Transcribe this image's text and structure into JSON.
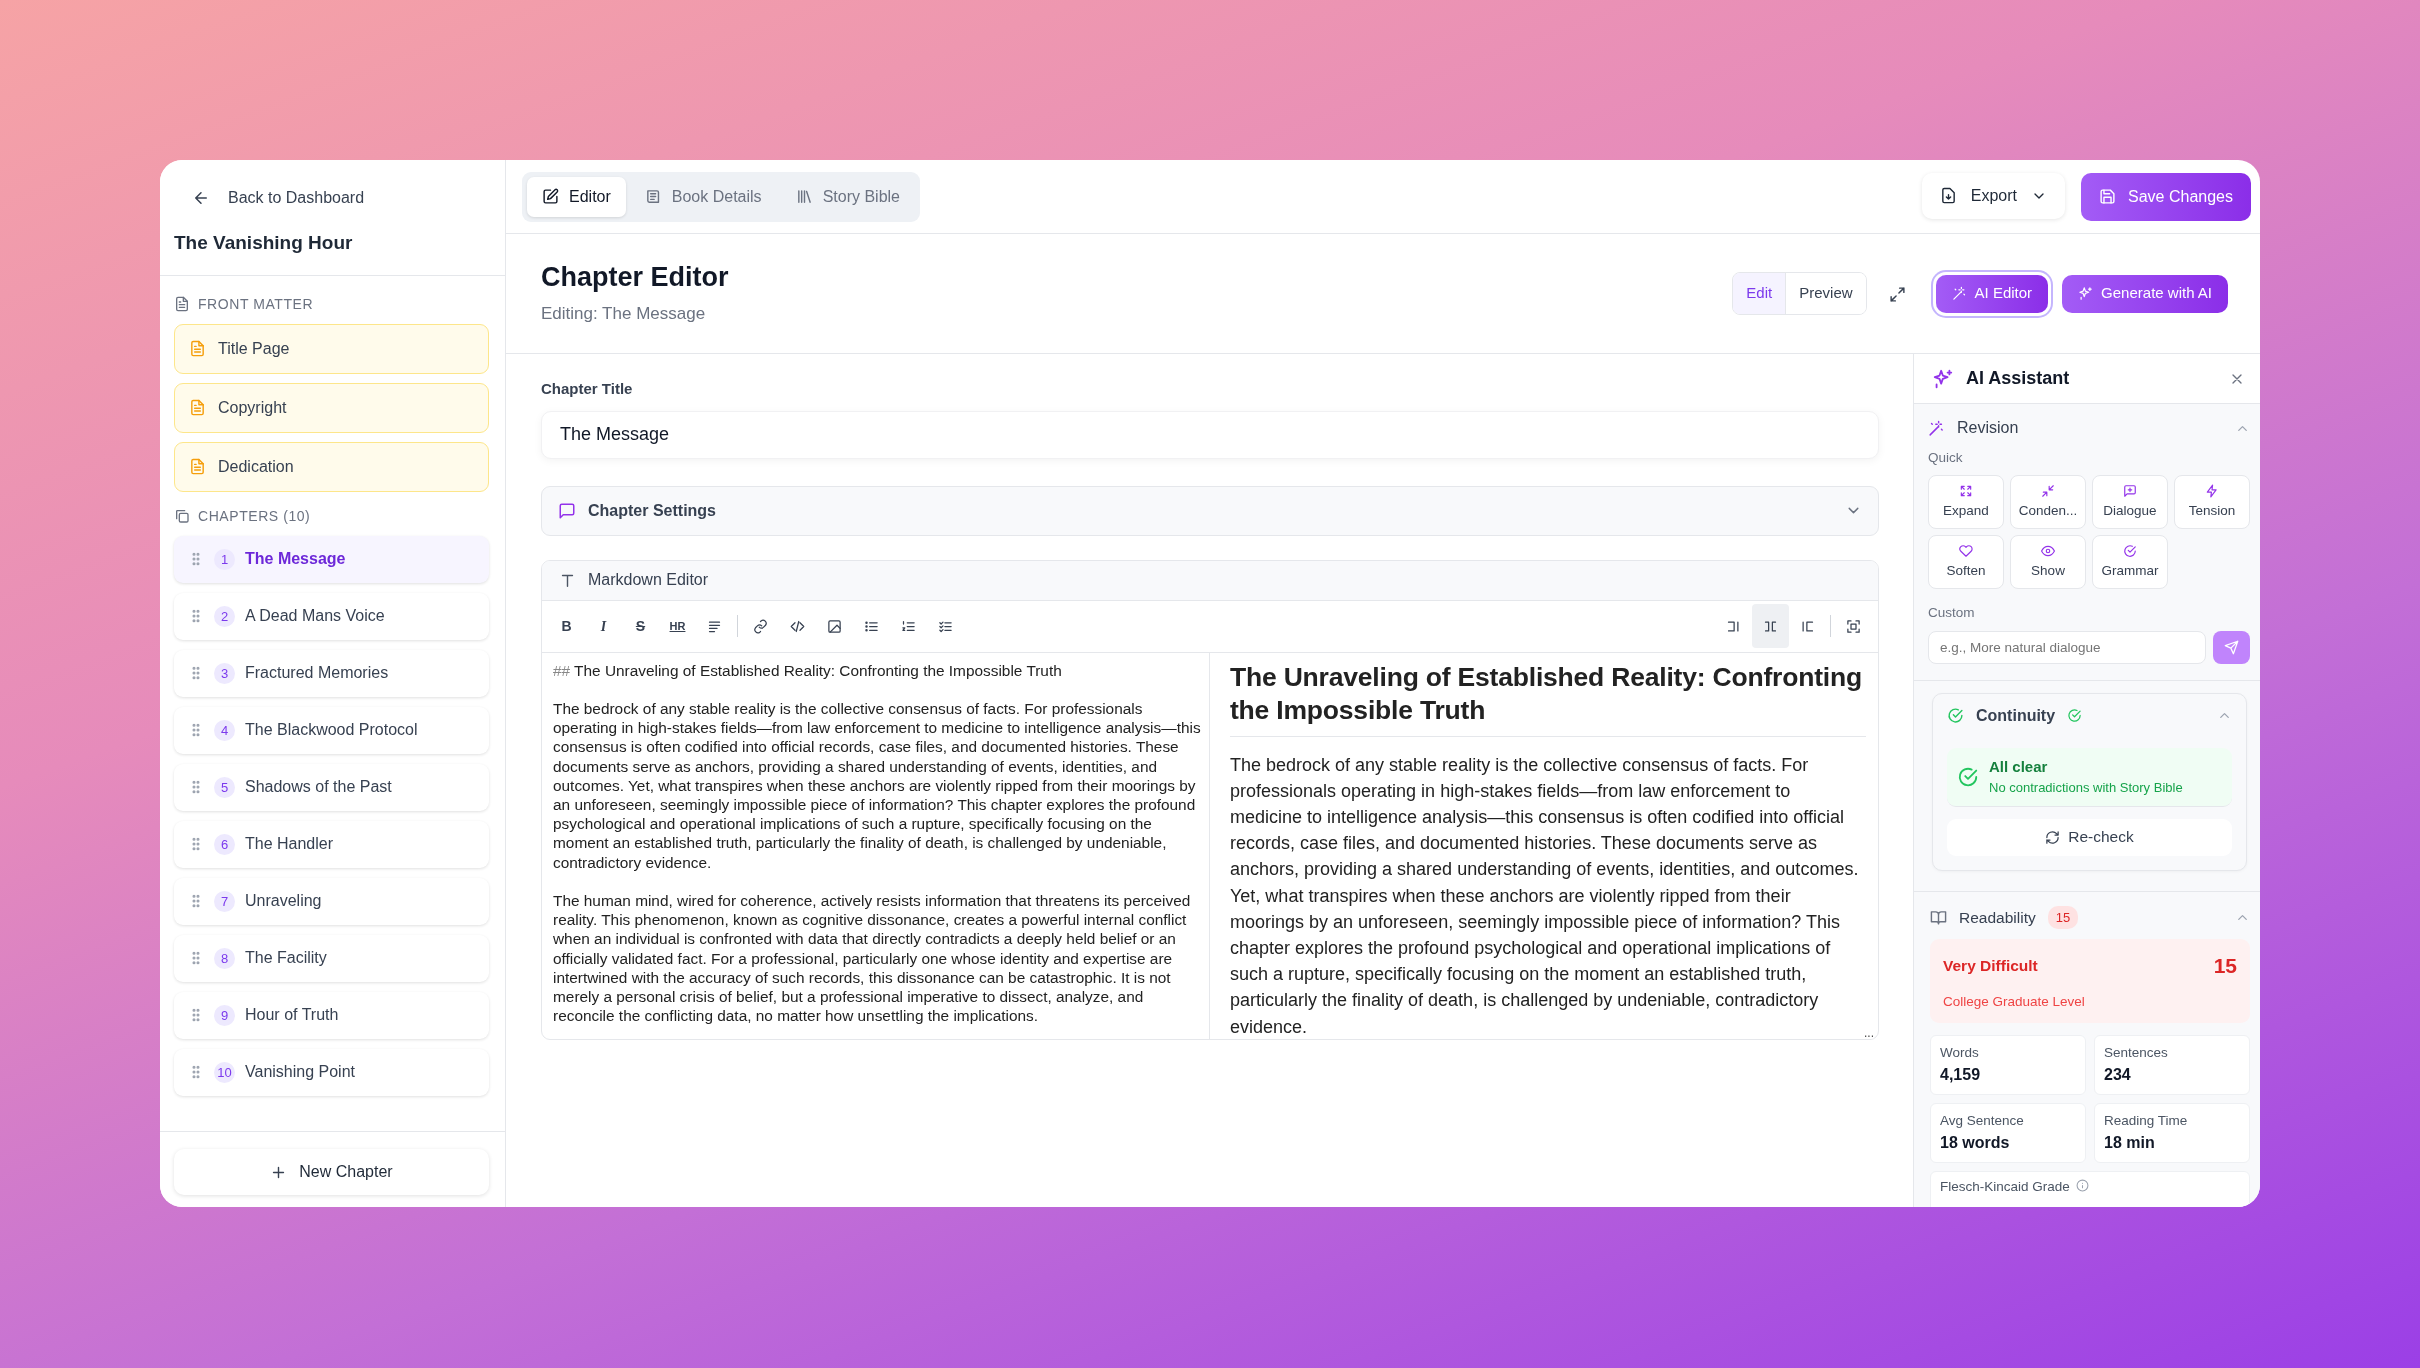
{
  "sidebar": {
    "back_link": "Back to Dashboard",
    "book_title": "The Vanishing Hour",
    "front_matter": {
      "heading": "FRONT MATTER",
      "items": [
        {
          "label": "Title Page"
        },
        {
          "label": "Copyright"
        },
        {
          "label": "Dedication"
        }
      ]
    },
    "chapters": {
      "heading": "CHAPTERS (10)",
      "items": [
        {
          "number": "1",
          "title": "The Message",
          "selected": true
        },
        {
          "number": "2",
          "title": "A Dead Mans Voice",
          "selected": false
        },
        {
          "number": "3",
          "title": "Fractured Memories",
          "selected": false
        },
        {
          "number": "4",
          "title": "The Blackwood Protocol",
          "selected": false
        },
        {
          "number": "5",
          "title": "Shadows of the Past",
          "selected": false
        },
        {
          "number": "6",
          "title": "The Handler",
          "selected": false
        },
        {
          "number": "7",
          "title": "Unraveling",
          "selected": false
        },
        {
          "number": "8",
          "title": "The Facility",
          "selected": false
        },
        {
          "number": "9",
          "title": "Hour of Truth",
          "selected": false
        },
        {
          "number": "10",
          "title": "Vanishing Point",
          "selected": false
        }
      ]
    },
    "new_chapter_button": "New Chapter"
  },
  "top_bar": {
    "tabs": [
      {
        "label": "Editor",
        "selected": true
      },
      {
        "label": "Book Details",
        "selected": false
      },
      {
        "label": "Story Bible",
        "selected": false
      }
    ],
    "export_button": "Export",
    "save_button": "Save Changes"
  },
  "header": {
    "title": "Chapter Editor",
    "subtitle": "Editing: The Message",
    "view_toggle": [
      {
        "label": "Edit",
        "selected": true
      },
      {
        "label": "Preview",
        "selected": false
      }
    ],
    "ai_editor_button": {
      "label": "AI Editor",
      "active": true
    },
    "generate_button": "Generate with AI"
  },
  "chapter_title": {
    "label": "Chapter Title",
    "value": "The Message"
  },
  "chapter_settings": {
    "label": "Chapter Settings",
    "expanded": false
  },
  "markdown_editor": {
    "label": "Markdown Editor",
    "format_glyphs": [
      "B",
      "I",
      "S",
      "HR"
    ],
    "layout_modes": [
      {
        "selected": false
      },
      {
        "selected": true
      },
      {
        "selected": false
      }
    ],
    "source": {
      "heading_marker": "##",
      "heading": "The Unraveling of Established Reality: Confronting the Impossible Truth",
      "paragraphs": [
        "The bedrock of any stable reality is the collective consensus of facts. For professionals operating in high-stakes fields—from law enforcement to medicine to intelligence analysis—this consensus is often codified into official records, case files, and documented histories. These documents serve as anchors, providing a shared understanding of events, identities, and outcomes. Yet, what transpires when these anchors are violently ripped from their moorings by an unforeseen, seemingly impossible piece of information? This chapter explores the profound psychological and operational implications of such a rupture, specifically focusing on the moment an established truth, particularly the finality of death, is challenged by undeniable, contradictory evidence.",
        "The human mind, wired for coherence, actively resists information that threatens its perceived reality. This phenomenon, known as cognitive dissonance, creates a powerful internal conflict when an individual is confronted with data that directly contradicts a deeply held belief or an officially validated fact. For a professional, particularly one whose identity and expertise are intertwined with the accuracy of such records, this dissonance can be catastrophic. It is not merely a personal crisis of belief, but a professional imperative to dissect, analyze, and reconcile the conflicting data, no matter how unsettling the implications."
      ]
    },
    "preview": {
      "heading": "The Unraveling of Established Reality: Confronting the Impossible Truth",
      "paragraphs": [
        "The bedrock of any stable reality is the collective consensus of facts. For professionals operating in high-stakes fields—from law enforcement to medicine to intelligence analysis—this consensus is often codified into official records, case files, and documented histories. These documents serve as anchors, providing a shared understanding of events, identities, and outcomes. Yet, what transpires when these anchors are violently ripped from their moorings by an unforeseen, seemingly impossible piece of information? This chapter explores the profound psychological and operational implications of such a rupture, specifically focusing on the moment an established truth, particularly the finality of death, is challenged by undeniable, contradictory evidence."
      ]
    },
    "more_marker": "..."
  },
  "ai_assistant": {
    "title": "AI Assistant",
    "revision": {
      "title": "Revision",
      "expanded": true,
      "quick_label": "Quick",
      "quick_actions": [
        "Expand",
        "Conden...",
        "Dialogue",
        "Tension",
        "Soften",
        "Show",
        "Grammar"
      ],
      "custom_label": "Custom",
      "custom_placeholder": "e.g., More natural dialogue"
    },
    "continuity": {
      "title": "Continuity",
      "expanded": true,
      "status_title": "All clear",
      "status_text": "No contradictions with Story Bible",
      "recheck_button": "Re-check"
    },
    "readability": {
      "title": "Readability",
      "expanded": true,
      "badge": "15",
      "level": "Very Difficult",
      "score": "15",
      "grade_text": "College Graduate Level",
      "stats": [
        {
          "label": "Words",
          "value": "4,159"
        },
        {
          "label": "Sentences",
          "value": "234"
        },
        {
          "label": "Avg Sentence",
          "value": "18 words"
        },
        {
          "label": "Reading Time",
          "value": "18 min"
        }
      ],
      "flesch_label": "Flesch-Kincaid Grade"
    }
  }
}
